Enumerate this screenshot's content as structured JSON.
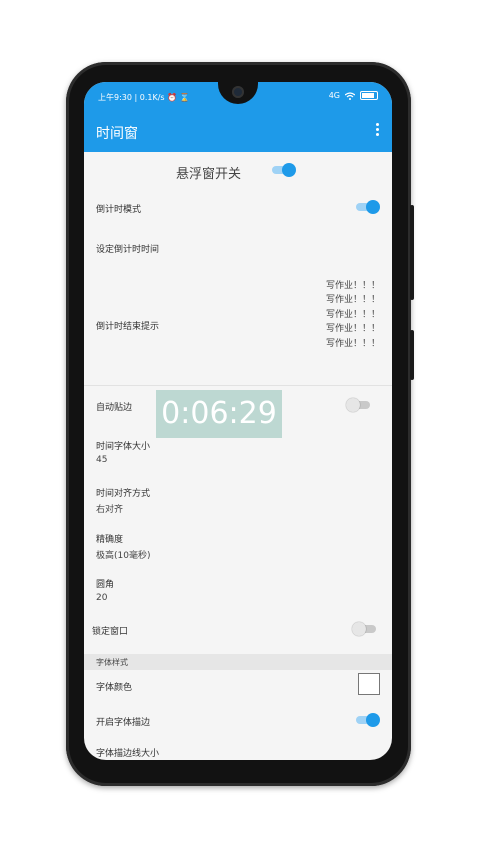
{
  "status_bar": {
    "left": "上午9:30 | 0.1K/s ⏰ ⌛",
    "signal": "4G",
    "wifi": "wifi-icon",
    "battery": "battery-icon"
  },
  "app_bar": {
    "title": "时间窗",
    "menu_icon": "more-vert-icon"
  },
  "settings": {
    "float_switch": {
      "label": "悬浮窗开关",
      "on": true
    },
    "countdown_mode": {
      "label": "倒计时模式",
      "on": true
    },
    "set_countdown": {
      "label": "设定倒计时时间"
    },
    "end_prompt": {
      "label": "倒计时结束提示",
      "messages": [
        "写作业！！！",
        "写作业！！！",
        "写作业！！！",
        "写作业！！！",
        "写作业！！！"
      ]
    },
    "auto_snap": {
      "label": "自动贴边",
      "on": false
    },
    "font_size": {
      "label": "时间字体大小",
      "value": "45"
    },
    "alignment": {
      "label": "时间对齐方式",
      "value": "右对齐"
    },
    "precision": {
      "label": "精确度",
      "value": "极高(10毫秒)"
    },
    "corner": {
      "label": "圆角",
      "value": "20"
    },
    "lock_window": {
      "label": "锁定窗口",
      "on": false
    },
    "font_style_header": "字体样式",
    "font_color": {
      "label": "字体颜色",
      "color": "#ffffff"
    },
    "font_stroke": {
      "label": "开启字体描边",
      "on": true
    },
    "stroke_size": {
      "label": "字体描边线大小"
    }
  },
  "floating_timer": {
    "text": "0:06:29"
  },
  "colors": {
    "accent": "#1e9ae9",
    "toggle_track_on": "#9fd2f5",
    "background": "#f5f5f5"
  }
}
